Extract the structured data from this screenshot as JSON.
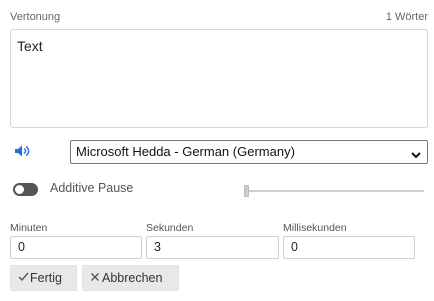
{
  "header": {
    "title": "Vertonung",
    "word_count": "1 Wörter"
  },
  "text_area": {
    "value": "Text"
  },
  "voice": {
    "icon": "speaker-icon",
    "selected": "Microsoft Hedda - German (Germany)"
  },
  "pause": {
    "label": "Additive Pause",
    "enabled": false,
    "slider_value": 0
  },
  "duration": {
    "minutes_label": "Minuten",
    "minutes_value": "0",
    "seconds_label": "Sekunden",
    "seconds_value": "3",
    "ms_label": "Millisekunden",
    "ms_value": "0"
  },
  "actions": {
    "done_label": "Fertig",
    "done_icon": "check-icon",
    "cancel_label": "Abbrechen",
    "cancel_icon": "close-icon"
  },
  "colors": {
    "accent": "#2a6fd6",
    "toggle_off": "#555555"
  }
}
